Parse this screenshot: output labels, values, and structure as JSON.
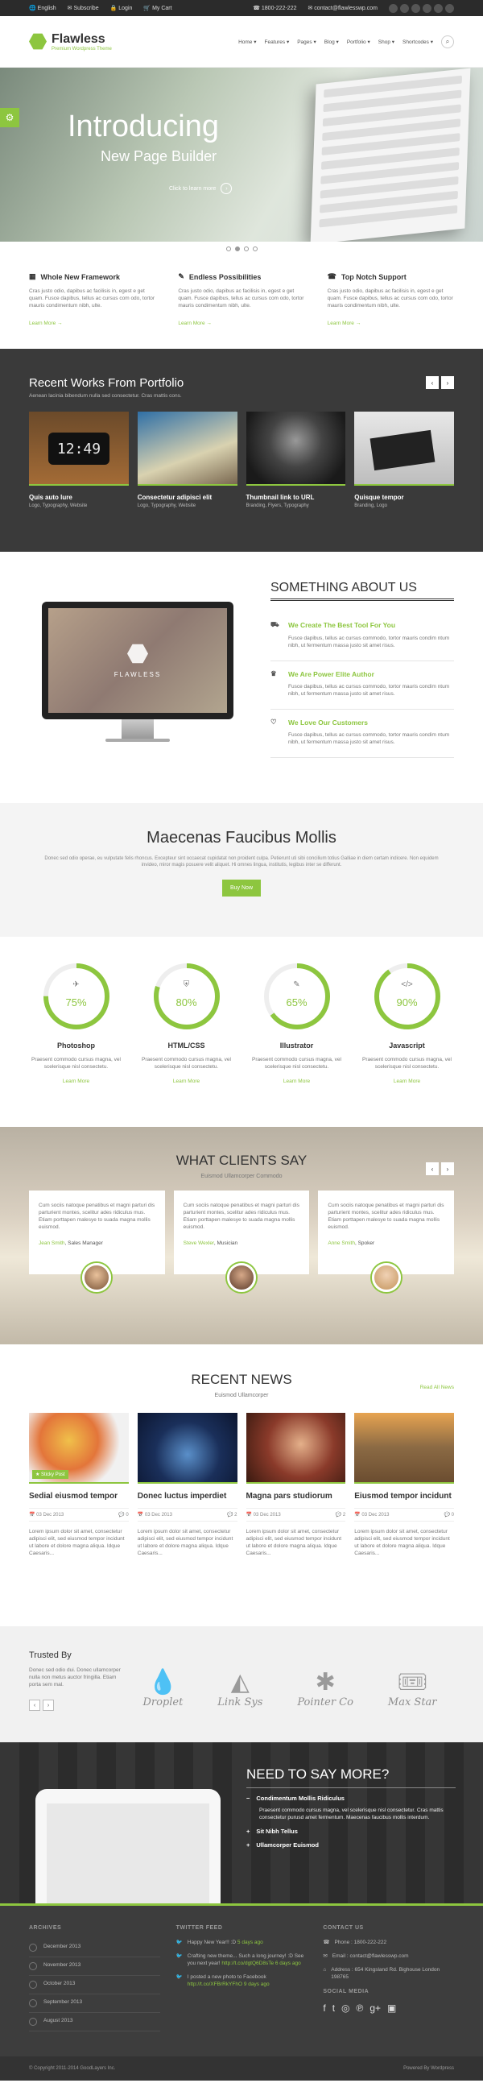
{
  "topbar": {
    "language": "English",
    "subscribe": "Subscribe",
    "login": "Login",
    "cart": "My Cart",
    "phone": "1800-222-222",
    "email": "contact@flawlesswp.com"
  },
  "header": {
    "logo": "Flawless",
    "tagline": "Premium Wordpress Theme",
    "nav": [
      "Home",
      "Features",
      "Pages",
      "Blog",
      "Portfolio",
      "Shop",
      "Shortcodes"
    ]
  },
  "hero": {
    "title": "Introducing",
    "subtitle": "New Page Builder",
    "cta": "Click to learn more",
    "slides_count": 4,
    "active_slide": 2
  },
  "features": [
    {
      "title": "Whole New Framework",
      "text": "Cras justo odio, dapibus ac facilisis in, egest e get quam. Fusce dapibus, tellus ac cursus com odo, tortor mauris condimentum nibh, ulte.",
      "link": "Learn More →"
    },
    {
      "title": "Endless Possibilities",
      "text": "Cras justo odio, dapibus ac facilisis in, egest e get quam. Fusce dapibus, tellus ac cursus com odo, tortor mauris condimentum nibh, ulte.",
      "link": "Learn More →"
    },
    {
      "title": "Top Notch Support",
      "text": "Cras justo odio, dapibus ac facilisis in, egest e get quam. Fusce dapibus, tellus ac cursus com odo, tortor mauris condimentum nibh, ulte.",
      "link": "Learn More →"
    }
  ],
  "portfolio": {
    "title": "Recent Works From Portfolio",
    "subtitle": "Aenean lacinia bibendum nulla sed consectetur. Cras mattis cons.",
    "items": [
      {
        "title": "Quis auto lure",
        "tags": "Logo, Typography, Website"
      },
      {
        "title": "Consectetur adipisci elit",
        "tags": "Logo, Typography, Website"
      },
      {
        "title": "Thumbnail link to URL",
        "tags": "Branding, Flyers, Typography"
      },
      {
        "title": "Quisque tempor",
        "tags": "Branding, Logo"
      }
    ],
    "clock_text": "12:49"
  },
  "about": {
    "screen_label": "FLAWLESS",
    "title": "SOMETHING ABOUT US",
    "items": [
      {
        "title": "We Create The Best Tool For You",
        "text": "Fusce dapibus, tellus ac cursus commodo, tortor mauris condim ntum nibh, ut fermentum massa justo sit amet risus."
      },
      {
        "title": "We Are Power Elite Author",
        "text": "Fusce dapibus, tellus ac cursus commodo, tortor mauris condim ntum nibh, ut fermentum massa justo sit amet risus."
      },
      {
        "title": "We Love Our Customers",
        "text": "Fusce dapibus, tellus ac cursus commodo, tortor mauris condim ntum nibh, ut fermentum massa justo sit amet risus."
      }
    ]
  },
  "cta": {
    "title": "Maecenas Faucibus Mollis",
    "text": "Donec sed odio operae, eu vulputate felis rhoncus. Excepteur sint occaecat cupidatat non proident culpa. Petierunt uti sibi concilium totius Galliae in diem certam indicere. Non equidem invideo, miror magis posuere velit aliquet. Hi omnes lingua, institutis, legibus inter se differunt.",
    "button": "Buy Now"
  },
  "skills": [
    {
      "name": "Photoshop",
      "pct": "75%",
      "value": 75,
      "icon": "airplane-icon",
      "text": "Praesent commodo cursus magna, vel scelerisque nisl consectetu.",
      "link": "Learn More"
    },
    {
      "name": "HTML/CSS",
      "pct": "80%",
      "value": 80,
      "icon": "html5-icon",
      "text": "Praesent commodo cursus magna, vel scelerisque nisl consectetu.",
      "link": "Learn More"
    },
    {
      "name": "Illustrator",
      "pct": "65%",
      "value": 65,
      "icon": "pencil-icon",
      "text": "Praesent commodo cursus magna, vel scelerisque nisl consectetu.",
      "link": "Learn More"
    },
    {
      "name": "Javascript",
      "pct": "90%",
      "value": 90,
      "icon": "code-icon",
      "text": "Praesent commodo cursus magna, vel scelerisque nisl consectetu.",
      "link": "Learn More"
    }
  ],
  "clients": {
    "title": "WHAT CLIENTS SAY",
    "subtitle": "Euismod Ullamcorper Commodo",
    "items": [
      {
        "text": "Cum sociis natoque penatibus et magni parturi dis parturient montes, scelitur ades ridiculus mus. Etiam porttapen malesye to suada magna mollis euismod.",
        "name": "Jean Smith",
        "role": ", Sales Manager"
      },
      {
        "text": "Cum sociis natoque penatibus et magni parturi dis parturient montes, scelitur ades ridiculus mus. Etiam porttapen malesye to suada magna mollis euismod.",
        "name": "Steve Wexler",
        "role": ", Musician"
      },
      {
        "text": "Cum sociis natoque penatibus et magni parturi dis parturient montes, scelitur ades ridiculus mus. Etiam porttapen malesye to suada magna mollis euismod.",
        "name": "Anne Smith",
        "role": ", Spoker"
      }
    ]
  },
  "news": {
    "title": "RECENT NEWS",
    "subtitle": "Euismod Ullamcorper",
    "read_all": "Read All News",
    "sticky": "Sticky Post",
    "posts": [
      {
        "title": "Sedial eiusmod tempor",
        "date": "03 Dec 2013",
        "comments": "0",
        "text": "Lorem ipsum dolor sit amet, consectetur adipisci elit, sed eiusmod tempor incidunt ut labore et dolore magna aliqua. Idque Caesaris..."
      },
      {
        "title": "Donec luctus imperdiet",
        "date": "03 Dec 2013",
        "comments": "2",
        "text": "Lorem ipsum dolor sit amet, consectetur adipisci elit, sed eiusmod tempor incidunt ut labore et dolore magna aliqua. Idque Caesaris..."
      },
      {
        "title": "Magna pars studiorum",
        "date": "03 Dec 2013",
        "comments": "2",
        "text": "Lorem ipsum dolor sit amet, consectetur adipisci elit, sed eiusmod tempor incidunt ut labore et dolore magna aliqua. Idque Caesaris..."
      },
      {
        "title": "Eiusmod tempor incidunt",
        "date": "03 Dec 2013",
        "comments": "0",
        "text": "Lorem ipsum dolor sit amet, consectetur adipisci elit, sed eiusmod tempor incidunt ut labore et dolore magna aliqua. Idque Caesaris..."
      }
    ]
  },
  "trusted": {
    "title": "Trusted By",
    "text": "Donec sed odio dui. Donec ullamcorper nulla non metus auctor fringilla. Etiam porta sem mal.",
    "brands": [
      {
        "name": "Droplet",
        "icon": "droplet-icon"
      },
      {
        "name": "Link Sys",
        "icon": "triangle-icon"
      },
      {
        "name": "Pointer Co",
        "icon": "asterisk-icon"
      },
      {
        "name": "Max Star",
        "icon": "ticket-icon"
      }
    ]
  },
  "needmore": {
    "title": "NEED TO SAY MORE?",
    "items": [
      {
        "title": "Condimentum Mollis Ridiculus",
        "text": "Praesent commodo cursus magna, vel scelerisque nisl consectetur. Cras mattis consectetur purusd amet fermentum. Maecenas faucibus mollis interdum."
      },
      {
        "title": "Sit Nibh Tellus",
        "text": ""
      },
      {
        "title": "Ullamcorper Euismod",
        "text": ""
      }
    ]
  },
  "footer": {
    "archives_title": "ARCHIVES",
    "archives": [
      "December 2013",
      "November 2013",
      "October 2013",
      "September 2013",
      "August 2013"
    ],
    "twitter_title": "TWITTER FEED",
    "tweets": [
      {
        "text": "Happy New Year!! :D",
        "ago": "5 days ago"
      },
      {
        "text": "Crafting new theme... Such a long journey! :D See you next year!",
        "ago": "http://t.co/dgtQ6D8sTe 6 days ago"
      },
      {
        "text": "I posted a new photo to Facebook",
        "ago": "http://t.co/XFBrRkYFhO 9 days ago"
      }
    ],
    "contact_title": "CONTACT US",
    "phone": "Phone : 1800-222-222",
    "email": "Email : contact@flawlesswp.com",
    "address": "Address : 654 Kingsland Rd. Bighouse London 198765",
    "social_title": "SOCIAL MEDIA",
    "copyright": "© Copyright 2011-2014 GoodLayers Inc.",
    "powered": "Powered By Wordpress"
  },
  "colors": {
    "accent": "#8dc63f",
    "dark": "#3a3a3a"
  }
}
